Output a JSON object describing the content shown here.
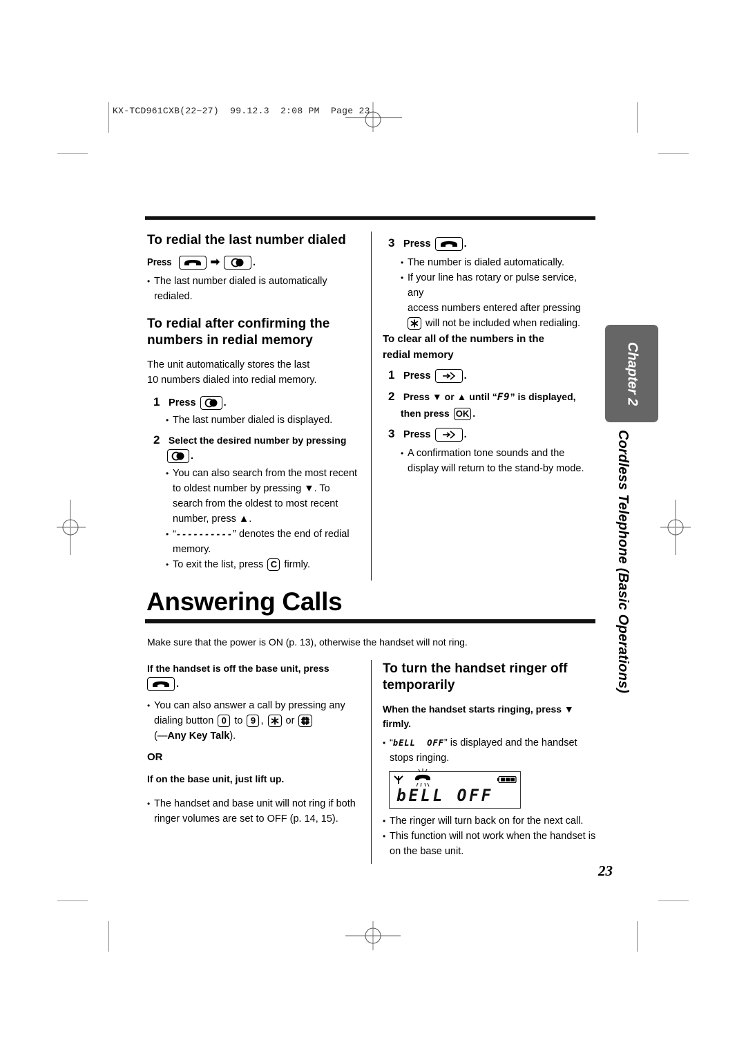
{
  "slug": {
    "model": "KX-TCD961CXB(22~27)",
    "date": "99.12.3",
    "time": "2:08 PM",
    "page_label": "Page 23"
  },
  "left_column": {
    "section1": {
      "heading": "To redial the last number dialed",
      "press_label": "Press",
      "bullet": "The last number dialed is automatically redialed."
    },
    "section2": {
      "heading_line1": "To redial after confirming the",
      "heading_line2": "numbers in redial memory",
      "intro_line1": "The unit automatically stores the last",
      "intro_line2": "10 numbers dialed into redial memory.",
      "step1": {
        "num": "1",
        "label": "Press",
        "bullet": "The last number dialed is displayed."
      },
      "step2": {
        "num": "2",
        "label": "Select the desired number by pressing",
        "bullets": [
          {
            "l1": "You can also search from the most recent",
            "l2": "to oldest number by pressing ▼. To",
            "l3": "search from the oldest to most recent",
            "l4": "number, press ▲."
          },
          {
            "pre": "“",
            "dashes": "----------",
            "post": "” denotes the end of redial",
            "l2": "memory."
          },
          {
            "pre": "To exit the list, press",
            "key": "C",
            "post": "firmly."
          }
        ]
      }
    }
  },
  "right_column": {
    "step3": {
      "num": "3",
      "label": "Press",
      "bullets": [
        "The number is dialed automatically.",
        {
          "l1": "If your line has rotary or pulse service, any",
          "l2": "access numbers entered after pressing",
          "l3": "will not be included when redialing."
        }
      ]
    },
    "clear": {
      "heading_line1": "To clear all of the numbers in the",
      "heading_line2": "redial memory",
      "step1": {
        "num": "1",
        "label": "Press"
      },
      "step2": {
        "num": "2",
        "line1_a": "Press ▼ or ▲ until “",
        "code": "F9",
        "line1_b": "” is displayed,",
        "line2": "then press",
        "key": "OK"
      },
      "step3": {
        "num": "3",
        "label": "Press",
        "bullet_l1": "A confirmation tone sounds and the",
        "bullet_l2": "display will return to the stand-by mode."
      }
    }
  },
  "answering": {
    "title": "Answering Calls",
    "intro": "Make sure that the power is ON (p. 13), otherwise the handset will not ring.",
    "offbase_heading": "If the handset is off the base unit, press",
    "anykey": {
      "l1": "You can also answer a call by pressing any",
      "l2_a": "dialing button",
      "key0": "0",
      "to": "to",
      "key9": "9",
      "or": "or",
      "l3_pre": "(—",
      "l3_bold": "Any Key Talk",
      "l3_post": ")."
    },
    "or_label": "OR",
    "onbase_heading": "If on the base unit, just lift up.",
    "onbase_bullet_l1": "The handset and base unit will not ring if both",
    "onbase_bullet_l2": "ringer volumes are set to OFF (p. 14, 15)."
  },
  "ringer_off": {
    "heading_line1": "To turn the handset ringer off",
    "heading_line2": "temporarily",
    "instruction_line1": "When the handset starts ringing, press ▼",
    "instruction_line2": "firmly.",
    "bullet1_pre": "“",
    "bullet1_code": "bELL  OFF",
    "bullet1_post": "” is displayed and the handset",
    "bullet1_l2": "stops ringing.",
    "lcd_text": "bELL OFF",
    "bullet2": "The ringer will turn back on for the next call.",
    "bullet3_l1": "This function will not work when the handset is",
    "bullet3_l2": "on the base unit."
  },
  "sidebar": {
    "chapter_tab": "Chapter 2",
    "section_title": "Cordless Telephone (Basic Operations)"
  },
  "page_number": "23",
  "icons": {
    "talk_key": "handset-talk-icon",
    "redial_key": "redial-icon",
    "function_key": "function-arrow-icon",
    "star_key": "star-key-icon",
    "pound_key": "pound-key-icon",
    "antenna": "antenna-icon",
    "ringing": "ringing-handset-icon",
    "battery": "battery-icon"
  },
  "colors": {
    "chapter_tab": "#666666",
    "text": "#000000",
    "crop_marks": "#999999"
  }
}
